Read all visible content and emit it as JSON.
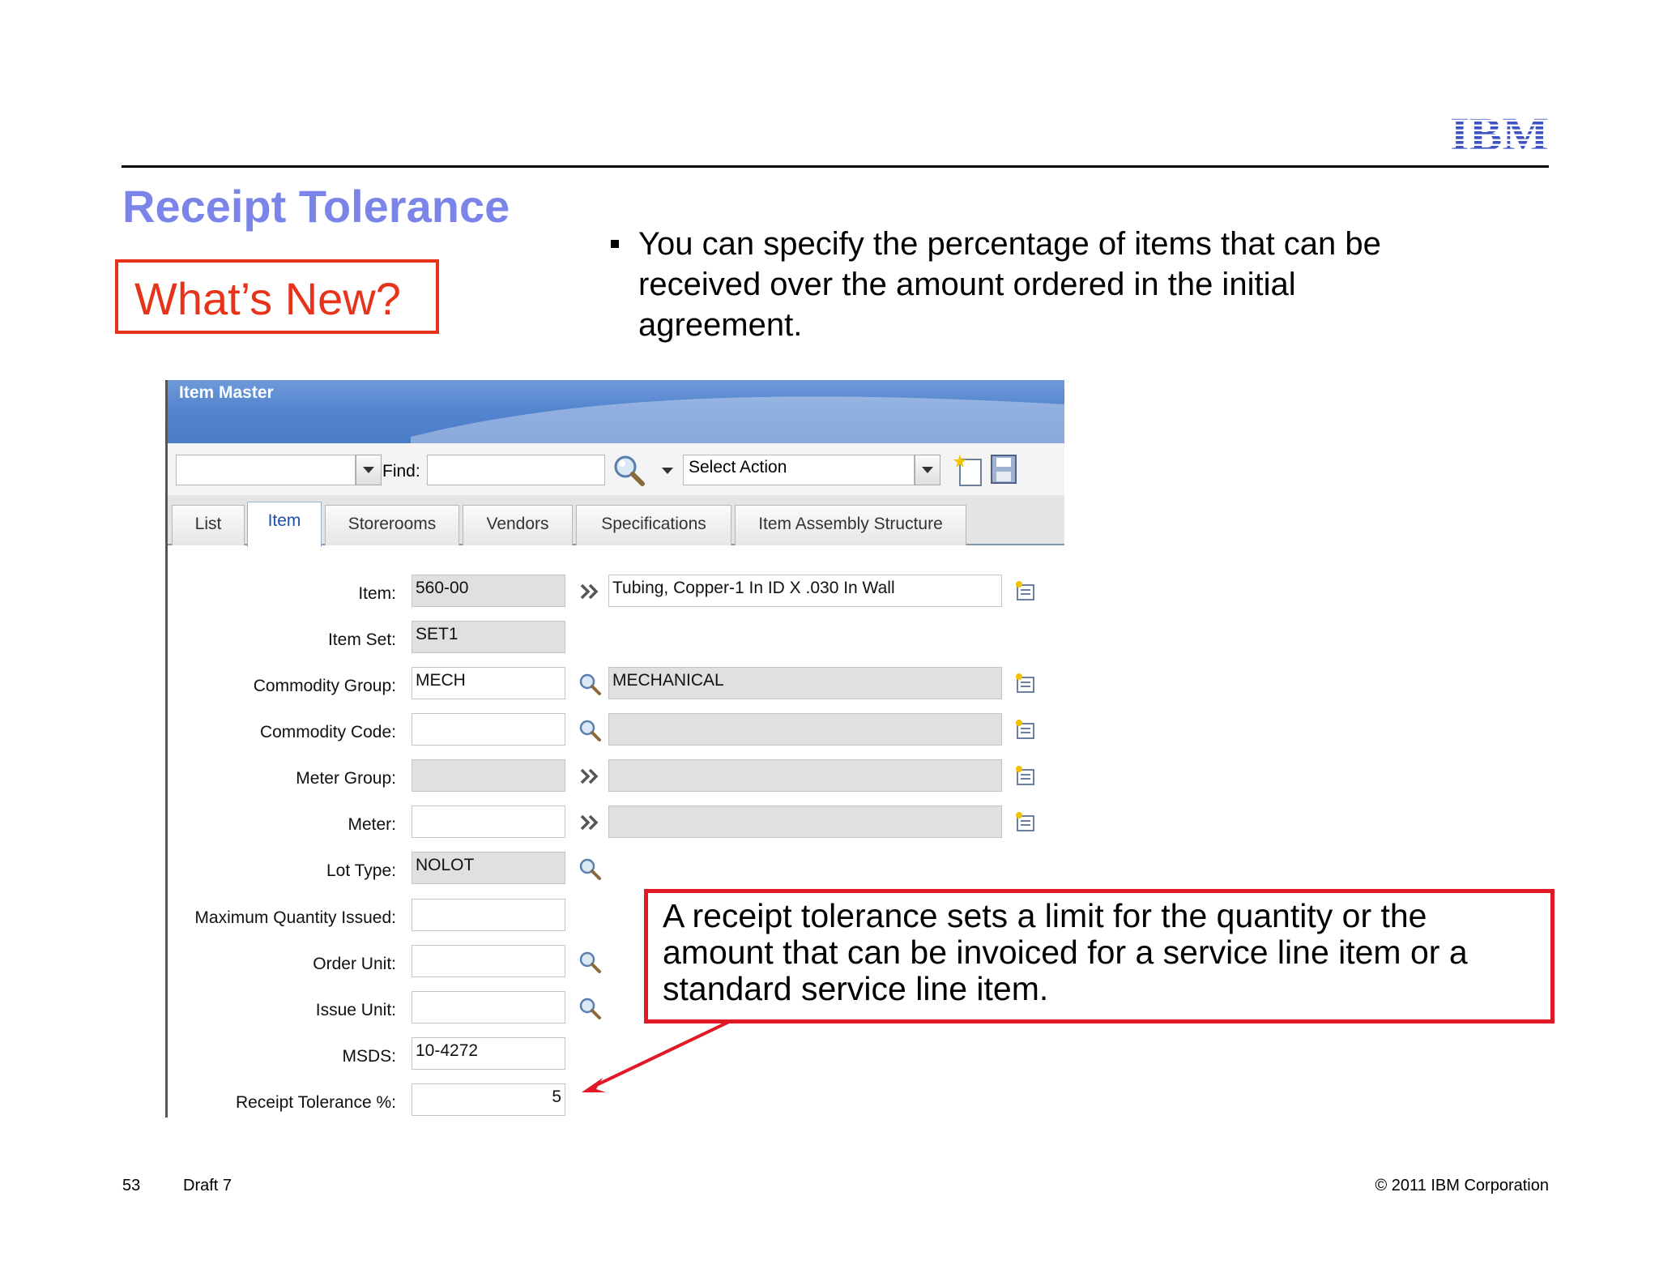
{
  "slide": {
    "logo_text": "IBM",
    "title": "Receipt Tolerance",
    "whats_new": "What’s New?",
    "bullet": "You can specify the percentage of items that can be received over the amount ordered in the initial agreement.",
    "callout": "A receipt tolerance sets a limit for the quantity or the amount that can be invoiced for a service line item or a standard service line item.",
    "footer": {
      "page": "53",
      "draft": "Draft 7",
      "copyright": "© 2011 IBM Corporation"
    },
    "colors": {
      "title": "#7b84e8",
      "whats_new": "#e8331b",
      "callout_border": "#e11927",
      "ibm_logo": "#3d53c2"
    }
  },
  "app": {
    "window_title": "Item Master",
    "toolbar": {
      "filter_value": "",
      "find_label": "Find:",
      "find_value": "",
      "select_action": "Select Action",
      "icons": [
        "search-icon",
        "new-record-icon",
        "save-icon"
      ]
    },
    "tabs": [
      "List",
      "Item",
      "Storerooms",
      "Vendors",
      "Specifications",
      "Item Assembly Structure"
    ],
    "active_tab": "Item",
    "fields": [
      {
        "label": "Item:",
        "value": "560-00",
        "description": "Tubing, Copper-1 In ID X .030 In Wall"
      },
      {
        "label": "Item Set:",
        "value": "SET1"
      },
      {
        "label": "Commodity Group:",
        "value": "MECH",
        "description": "MECHANICAL"
      },
      {
        "label": "Commodity Code:",
        "value": "",
        "description": ""
      },
      {
        "label": "Meter Group:",
        "value": "",
        "description": ""
      },
      {
        "label": "Meter:",
        "value": "",
        "description": ""
      },
      {
        "label": "Lot Type:",
        "value": "NOLOT"
      },
      {
        "label": "Maximum Quantity Issued:",
        "value": ""
      },
      {
        "label": "Order Unit:",
        "value": ""
      },
      {
        "label": "Issue Unit:",
        "value": ""
      },
      {
        "label": "MSDS:",
        "value": "10-4272"
      },
      {
        "label": "Receipt Tolerance %:",
        "value": "5"
      }
    ]
  }
}
